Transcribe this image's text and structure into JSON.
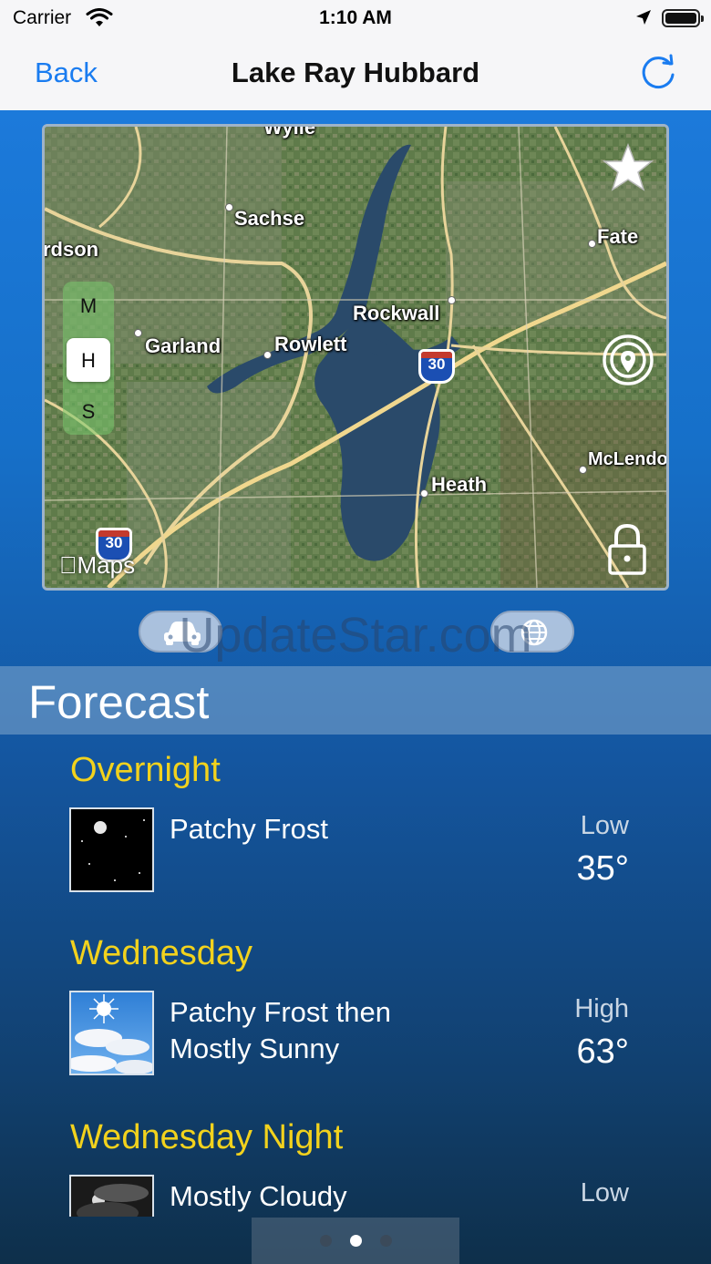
{
  "status_bar": {
    "carrier": "Carrier",
    "time": "1:10 AM"
  },
  "nav": {
    "back_label": "Back",
    "title": "Lake Ray Hubbard"
  },
  "map": {
    "labels": {
      "wylie": "Wylie",
      "sachse": "Sachse",
      "rdson": "rdson",
      "fate": "Fate",
      "rockwall": "Rockwall",
      "garland": "Garland",
      "rowlett": "Rowlett",
      "mclendon": "McLendo",
      "heath": "Heath"
    },
    "highway": "30",
    "map_type_options": [
      "M",
      "H",
      "S"
    ],
    "map_type_selected": "H",
    "maps_logo": "Maps",
    "icons": [
      "star-icon",
      "location-target-icon",
      "lock-icon"
    ]
  },
  "buttons": {
    "left_icon": "car-icon",
    "right_icon": "globe-icon"
  },
  "watermark": "UpdateStar.com",
  "forecast": {
    "title": "Forecast",
    "periods": [
      {
        "name": "Overnight",
        "description": "Patchy Frost",
        "hl_label": "Low",
        "temp": "35°",
        "icon": "night-clear-icon"
      },
      {
        "name": "Wednesday",
        "description": "Patchy Frost then Mostly Sunny",
        "hl_label": "High",
        "temp": "63°",
        "icon": "sunny-clouds-icon"
      },
      {
        "name": "Wednesday Night",
        "description": "Mostly Cloudy",
        "hl_label": "Low",
        "temp": "",
        "icon": "night-cloudy-icon"
      }
    ]
  },
  "pager": {
    "pages": 3,
    "current": 2
  },
  "colors": {
    "accent": "#1a7cf0",
    "period_name": "#f2d21d",
    "background_top": "#1e7de0",
    "background_bottom": "#0e2f4a"
  }
}
